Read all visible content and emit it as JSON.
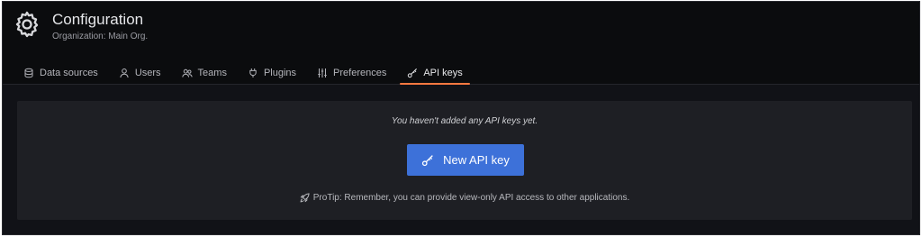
{
  "header": {
    "title": "Configuration",
    "subtitle": "Organization: Main Org.",
    "icon": "gear-icon"
  },
  "tabs": [
    {
      "label": "Data sources",
      "icon": "database-icon",
      "active": false
    },
    {
      "label": "Users",
      "icon": "user-icon",
      "active": false
    },
    {
      "label": "Teams",
      "icon": "users-icon",
      "active": false
    },
    {
      "label": "Plugins",
      "icon": "plug-icon",
      "active": false
    },
    {
      "label": "Preferences",
      "icon": "sliders-icon",
      "active": false
    },
    {
      "label": "API keys",
      "icon": "key-icon",
      "active": true
    }
  ],
  "empty_state": {
    "message": "You haven't added any API keys yet.",
    "button_label": "New API key",
    "button_icon": "key-icon",
    "protip_icon": "rocket-icon",
    "protip": "ProTip: Remember, you can provide view-only API access to other applications."
  },
  "colors": {
    "background": "#111217",
    "header": "#0b0c0e",
    "panel": "#1e1f24",
    "primary_button": "#3d71d9",
    "active_tab_underline": "#ff7941"
  }
}
